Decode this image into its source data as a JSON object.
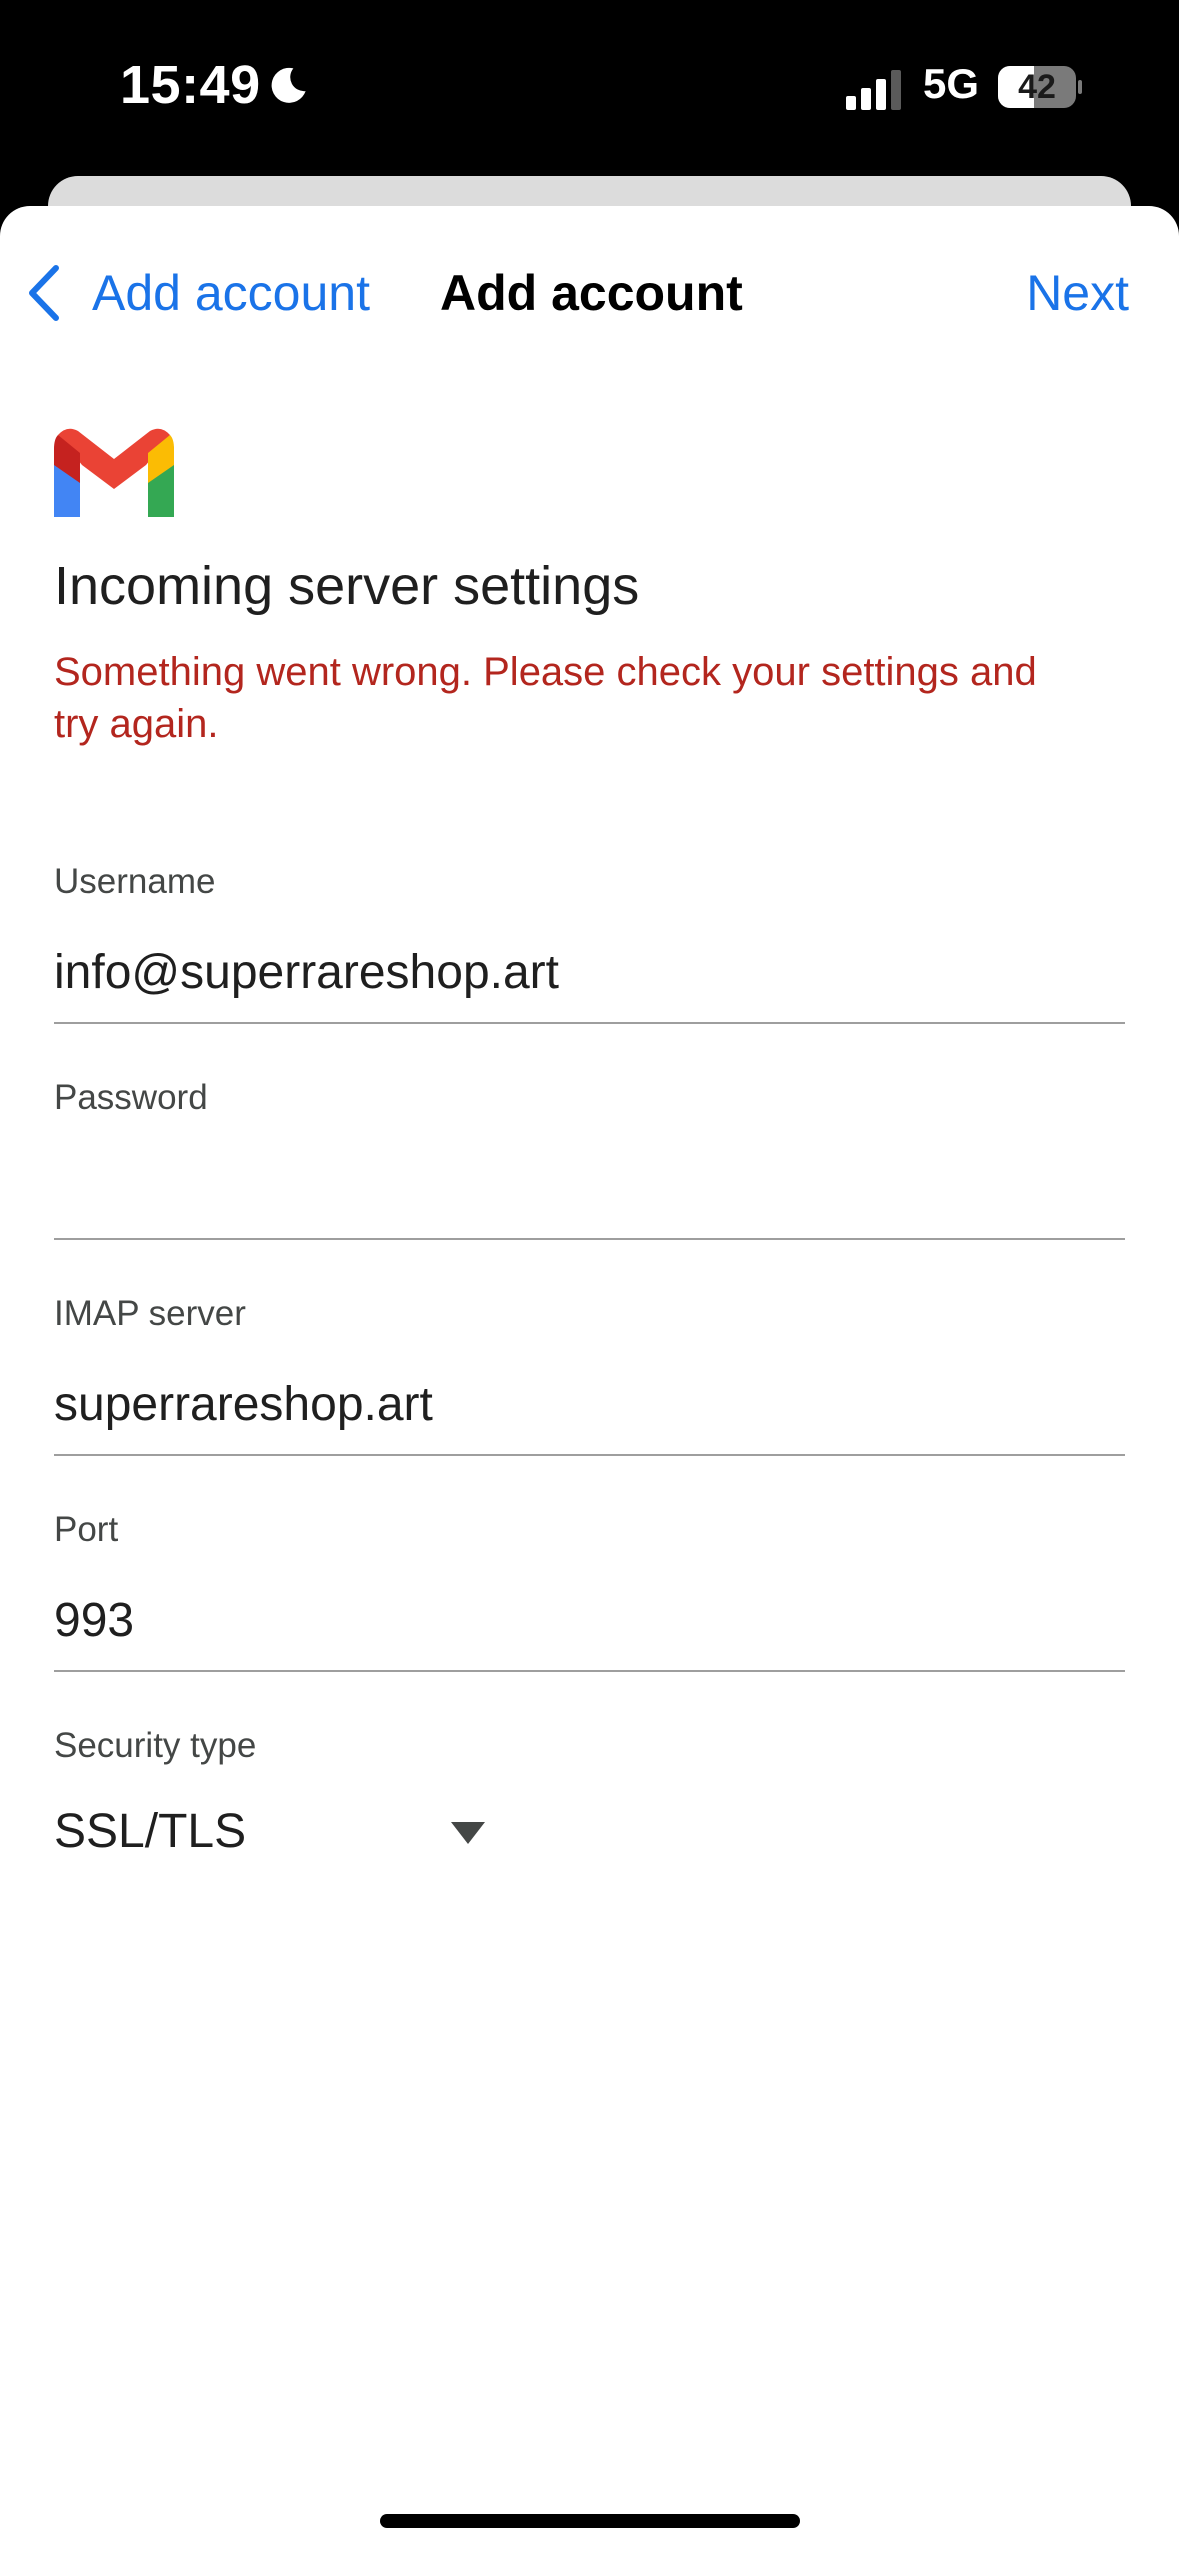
{
  "status_bar": {
    "time": "15:49",
    "network": "5G",
    "battery": "42",
    "icons": [
      "moon-icon",
      "signal-icon",
      "battery-icon"
    ]
  },
  "nav": {
    "back_label": "Add account",
    "title": "Add account",
    "next_label": "Next"
  },
  "colors": {
    "accent": "#1a73e8",
    "error": "#b3261e",
    "text": "#1f1f1f",
    "label": "#444746"
  },
  "page": {
    "heading": "Incoming server settings",
    "error": "Something went wrong. Please check your settings and try again."
  },
  "fields": {
    "username": {
      "label": "Username",
      "value": "info@superrareshop.art"
    },
    "password": {
      "label": "Password",
      "value": ""
    },
    "imap_server": {
      "label": "IMAP server",
      "value": "superrareshop.art"
    },
    "port": {
      "label": "Port",
      "value": "993"
    },
    "security": {
      "label": "Security type",
      "value": "SSL/TLS"
    }
  }
}
